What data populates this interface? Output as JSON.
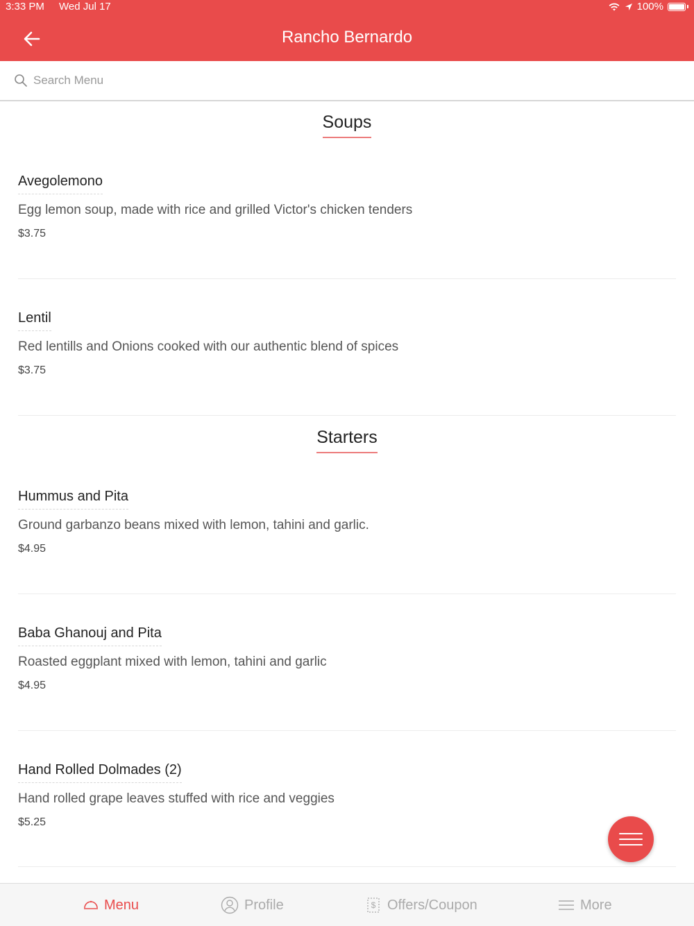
{
  "status_bar": {
    "time": "3:33 PM",
    "date": "Wed Jul 17",
    "battery": "100%"
  },
  "header": {
    "title": "Rancho Bernardo",
    "back_icon": "arrow-left-icon"
  },
  "search": {
    "placeholder": "Search Menu",
    "value": ""
  },
  "sections": [
    {
      "title": "Soups",
      "items": [
        {
          "name": "Avegolemono",
          "description": "Egg lemon soup, made with rice and grilled Victor's chicken tenders",
          "price": "$3.75"
        },
        {
          "name": "Lentil",
          "description": "Red lentills and Onions cooked with our authentic blend of spices",
          "price": "$3.75"
        }
      ]
    },
    {
      "title": "Starters",
      "items": [
        {
          "name": "Hummus and Pita",
          "description": "Ground garbanzo beans mixed with lemon, tahini and garlic.",
          "price": "$4.95"
        },
        {
          "name": "Baba Ghanouj and Pita",
          "description": "Roasted eggplant mixed with lemon, tahini and garlic",
          "price": "$4.95"
        },
        {
          "name": "Hand Rolled Dolmades (2)",
          "description": "Hand rolled grape leaves stuffed with rice and veggies",
          "price": "$5.25"
        }
      ]
    }
  ],
  "fab": {
    "icon": "hamburger-menu-icon"
  },
  "tabs": [
    {
      "label": "Menu",
      "icon": "dish-cloche-icon",
      "active": true
    },
    {
      "label": "Profile",
      "icon": "user-circle-icon",
      "active": false
    },
    {
      "label": "Offers/Coupon",
      "icon": "coupon-icon",
      "active": false
    },
    {
      "label": "More",
      "icon": "list-icon",
      "active": false
    }
  ],
  "colors": {
    "accent": "#e94b4b",
    "section_underline": "#ec7b7b",
    "inactive_tab": "#aaaaaa"
  }
}
